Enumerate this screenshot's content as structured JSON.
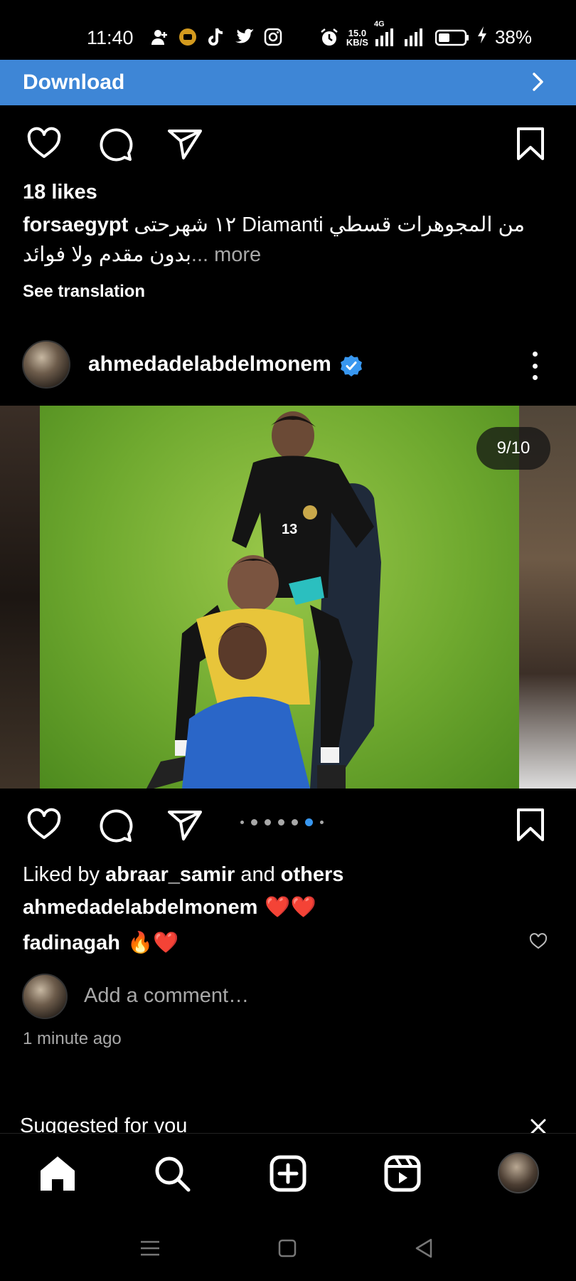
{
  "status_bar": {
    "time": "11:40",
    "app_icons": [
      "person-add-icon",
      "record-icon",
      "tiktok-icon",
      "twitter-icon",
      "instagram-icon"
    ],
    "alarm_icon": "alarm-icon",
    "net_speed_value": "15.0",
    "net_speed_unit": "KB/S",
    "network_label": "4G",
    "battery": "38%"
  },
  "banner": {
    "download_label": "Download"
  },
  "previous_post": {
    "likes": "18 likes",
    "caption_user": "forsaegypt",
    "caption_text_line1": "من المجوهرات قسطي Diamanti  ١٢ شهرحتى",
    "caption_text_line2": "بدون مقدم  ولا فوائد",
    "more_label": "... more",
    "see_translation": "See translation"
  },
  "post": {
    "username": "ahmedadelabdelmonem",
    "verified": true,
    "page_counter": "9/10",
    "carousel_total_dots": 7,
    "carousel_active_index": 5,
    "liked_by_prefix": "Liked by",
    "liked_by_user": "abraar_samir",
    "liked_by_and": "and",
    "liked_by_others": "others",
    "comments": [
      {
        "user": "ahmedadelabdelmonem",
        "emoji": "❤️❤️"
      },
      {
        "user": "fadinagah",
        "emoji": "🔥❤️"
      }
    ],
    "add_comment_placeholder": "Add a comment…",
    "time_ago": "1 minute ago"
  },
  "suggested": {
    "title": "Suggested for you"
  },
  "bottom_nav": {
    "items": [
      "home-icon",
      "search-icon",
      "create-icon",
      "reels-icon",
      "profile-avatar"
    ]
  },
  "colors": {
    "banner_blue": "#3e86d6",
    "verified_blue": "#3897f0",
    "secondary_text": "#a8a8a8",
    "heart_red": "#ed1c24"
  }
}
